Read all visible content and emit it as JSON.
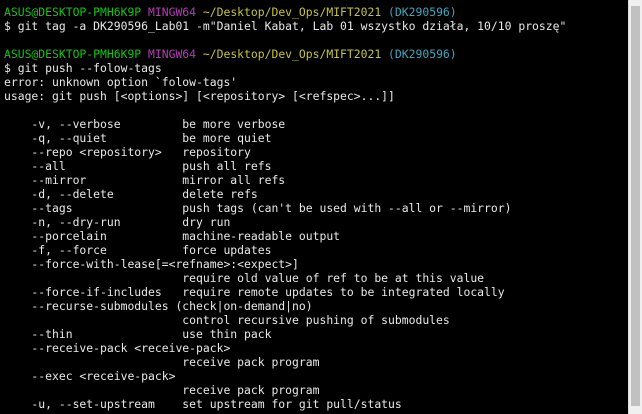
{
  "colors": {
    "background": "#000000",
    "text": "#e8e8e8",
    "prompt_user": "#13c50f",
    "prompt_mingw": "#b73bb7",
    "prompt_path": "#c6c43a",
    "prompt_branch": "#3aa8c2",
    "scrollbar": "#f0f0f0"
  },
  "lines": [
    [
      {
        "t": "ASUS@DESKTOP-PMH6K9P ",
        "c": "green"
      },
      {
        "t": "MINGW64 ",
        "c": "magenta"
      },
      {
        "t": "~/Desktop/Dev_Ops/MIFT2021",
        "c": "yellow"
      },
      {
        "t": " (DK290596)",
        "c": "cyan"
      }
    ],
    [
      {
        "t": "$ git tag -a DK290596_Lab01 -m\"Daniel Kabat, Lab 01 wszystko działa, 10/10 proszę\"",
        "c": "white"
      }
    ],
    [],
    [
      {
        "t": "ASUS@DESKTOP-PMH6K9P ",
        "c": "green"
      },
      {
        "t": "MINGW64 ",
        "c": "magenta"
      },
      {
        "t": "~/Desktop/Dev_Ops/MIFT2021",
        "c": "yellow"
      },
      {
        "t": " (DK290596)",
        "c": "cyan"
      }
    ],
    [
      {
        "t": "$ git push --folow-tags",
        "c": "white"
      }
    ],
    [
      {
        "t": "error: unknown option `folow-tags'",
        "c": "white"
      }
    ],
    [
      {
        "t": "usage: git push [<options>] [<repository> [<refspec>...]]",
        "c": "white"
      }
    ],
    [],
    [
      {
        "t": "    -v, --verbose         be more verbose",
        "c": "white"
      }
    ],
    [
      {
        "t": "    -q, --quiet           be more quiet",
        "c": "white"
      }
    ],
    [
      {
        "t": "    --repo <repository>   repository",
        "c": "white"
      }
    ],
    [
      {
        "t": "    --all                 push all refs",
        "c": "white"
      }
    ],
    [
      {
        "t": "    --mirror              mirror all refs",
        "c": "white"
      }
    ],
    [
      {
        "t": "    -d, --delete          delete refs",
        "c": "white"
      }
    ],
    [
      {
        "t": "    --tags                push tags (can't be used with --all or --mirror)",
        "c": "white"
      }
    ],
    [
      {
        "t": "    -n, --dry-run         dry run",
        "c": "white"
      }
    ],
    [
      {
        "t": "    --porcelain           machine-readable output",
        "c": "white"
      }
    ],
    [
      {
        "t": "    -f, --force           force updates",
        "c": "white"
      }
    ],
    [
      {
        "t": "    --force-with-lease[=<refname>:<expect>]",
        "c": "white"
      }
    ],
    [
      {
        "t": "                          require old value of ref to be at this value",
        "c": "white"
      }
    ],
    [
      {
        "t": "    --force-if-includes   require remote updates to be integrated locally",
        "c": "white"
      }
    ],
    [
      {
        "t": "    --recurse-submodules (check|on-demand|no)",
        "c": "white"
      }
    ],
    [
      {
        "t": "                          control recursive pushing of submodules",
        "c": "white"
      }
    ],
    [
      {
        "t": "    --thin                use thin pack",
        "c": "white"
      }
    ],
    [
      {
        "t": "    --receive-pack <receive-pack>",
        "c": "white"
      }
    ],
    [
      {
        "t": "                          receive pack program",
        "c": "white"
      }
    ],
    [
      {
        "t": "    --exec <receive-pack>",
        "c": "white"
      }
    ],
    [
      {
        "t": "                          receive pack program",
        "c": "white"
      }
    ],
    [
      {
        "t": "    -u, --set-upstream    set upstream for git pull/status",
        "c": "white"
      }
    ]
  ]
}
